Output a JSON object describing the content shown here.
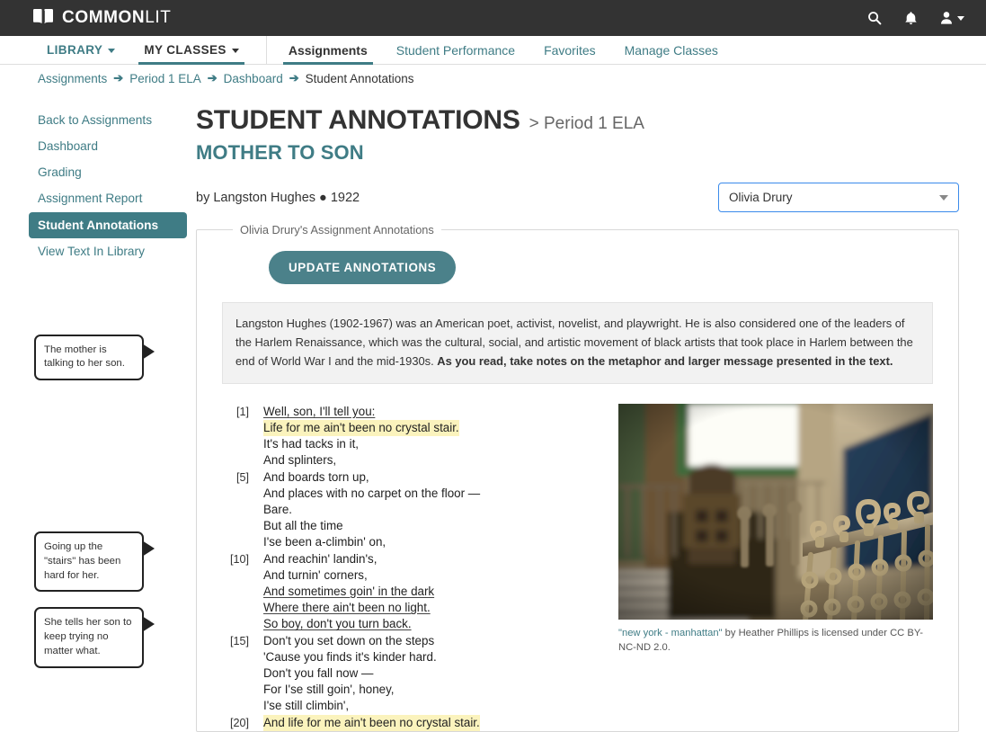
{
  "topbar": {
    "logo_bold": "COMMON",
    "logo_light": "LIT",
    "logo_icon": "open-book-icon",
    "search_icon": "search-icon",
    "bell_icon": "bell-notification-icon",
    "user_icon": "user-account-icon"
  },
  "nav": {
    "library": "LIBRARY",
    "my_classes": "MY CLASSES",
    "tabs": [
      {
        "label": "Assignments",
        "selected": true
      },
      {
        "label": "Student Performance",
        "selected": false
      },
      {
        "label": "Favorites",
        "selected": false
      },
      {
        "label": "Manage Classes",
        "selected": false
      }
    ]
  },
  "breadcrumb": {
    "arrow": "➔",
    "items": [
      {
        "label": "Assignments",
        "current": false
      },
      {
        "label": "Period 1 ELA",
        "current": false
      },
      {
        "label": "Dashboard",
        "current": false
      },
      {
        "label": "Student Annotations",
        "current": true
      }
    ]
  },
  "sidebar": {
    "items": [
      {
        "label": "Back to Assignments",
        "active": false
      },
      {
        "label": "Dashboard",
        "active": false
      },
      {
        "label": "Grading",
        "active": false
      },
      {
        "label": "Assignment Report",
        "active": false
      },
      {
        "label": "Student Annotations",
        "active": true
      },
      {
        "label": "View Text In Library",
        "active": false
      }
    ]
  },
  "callouts": [
    {
      "text": "The mother is talking to her son."
    },
    {
      "text": "Going up the \"stairs\" has been hard for her."
    },
    {
      "text": "She tells her son to keep trying no matter what."
    }
  ],
  "header": {
    "title": "STUDENT ANNOTATIONS",
    "title_suffix": "> Period 1 ELA",
    "subtitle": "MOTHER TO SON",
    "byline": "by Langston Hughes ● 1922"
  },
  "student_select": {
    "value": "Olivia Drury",
    "caret_icon": "chevron-down-icon"
  },
  "annotations_panel": {
    "legend": "Olivia Drury's Assignment Annotations",
    "update_button": "UPDATE ANNOTATIONS",
    "intro_text": "Langston Hughes (1902-1967) was an American poet, activist, novelist, and playwright. He is also considered one of the leaders of the Harlem Renaissance, which was the cultural, social, and artistic movement of black artists that took place in Harlem between the end of World War I and the mid-1930s. ",
    "intro_bold": "As you read, take notes on the metaphor and larger message presented in the text."
  },
  "poem": {
    "lines": [
      {
        "num": "[1]",
        "text": "Well, son, I'll tell you:",
        "style": "underline"
      },
      {
        "num": "",
        "text": "Life for me ain't been no crystal stair.",
        "style": "highlight"
      },
      {
        "num": "",
        "text": "It's had tacks in it,",
        "style": ""
      },
      {
        "num": "",
        "text": "And splinters,",
        "style": ""
      },
      {
        "num": "[5]",
        "text": "And boards torn up,",
        "style": ""
      },
      {
        "num": "",
        "text": "And places with no carpet on the floor —",
        "style": ""
      },
      {
        "num": "",
        "text": "Bare.",
        "style": ""
      },
      {
        "num": "",
        "text": "But all the time",
        "style": ""
      },
      {
        "num": "",
        "text": "I'se been a-climbin' on,",
        "style": ""
      },
      {
        "num": "[10]",
        "text": "And reachin' landin's,",
        "style": ""
      },
      {
        "num": "",
        "text": "And turnin' corners,",
        "style": ""
      },
      {
        "num": "",
        "text": "And sometimes goin' in the dark",
        "style": "underline"
      },
      {
        "num": "",
        "text": "Where there ain't been no light.",
        "style": "underline"
      },
      {
        "num": "",
        "text": "So boy, don't you turn back.",
        "style": "underline"
      },
      {
        "num": "[15]",
        "text": "Don't you set down on the steps",
        "style": ""
      },
      {
        "num": "",
        "text": "'Cause you finds it's kinder hard.",
        "style": ""
      },
      {
        "num": "",
        "text": "Don't you fall now —",
        "style": ""
      },
      {
        "num": "",
        "text": "For I'se still goin', honey,",
        "style": ""
      },
      {
        "num": "",
        "text": "I'se still climbin',",
        "style": ""
      },
      {
        "num": "[20]",
        "text": "And life for me ain't been no crystal stair.",
        "style": "highlight"
      }
    ]
  },
  "figure": {
    "alt": "ornate wrought-iron staircase railing in a stairwell",
    "caption_link": "\"new york - manhattan\"",
    "caption_rest": " by Heather Phillips is licensed under CC BY-NC-ND 2.0."
  },
  "colors": {
    "brand_teal": "#3f7c85",
    "topbar_dark": "#333333",
    "highlight_yellow": "#fbf3bd",
    "select_border_blue": "#3b8beb"
  }
}
